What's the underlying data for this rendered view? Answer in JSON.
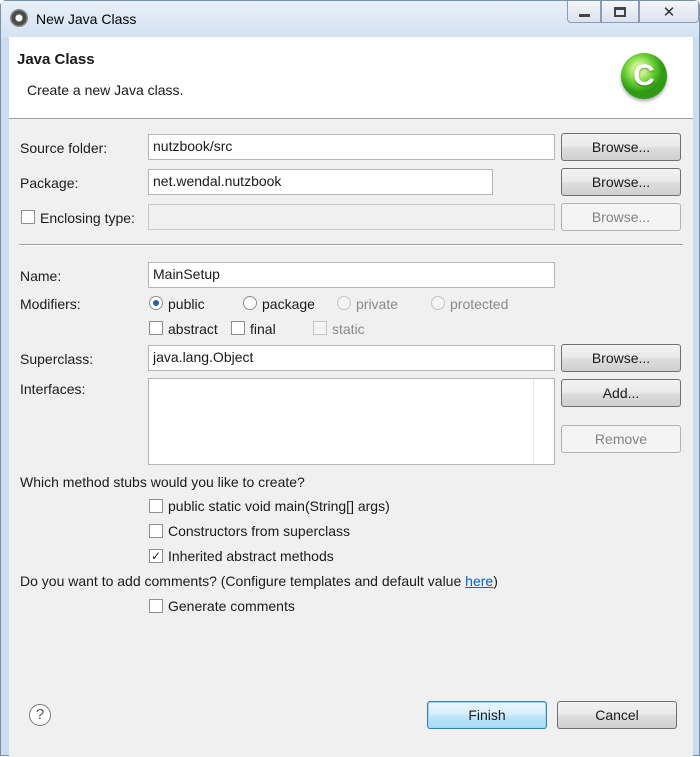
{
  "window": {
    "title": "New Java Class"
  },
  "header": {
    "title": "Java Class",
    "subtitle": "Create a new Java class.",
    "icon_letter": "C"
  },
  "form": {
    "source_folder": {
      "label": "Source folder:",
      "value": "nutzbook/src",
      "browse": "Browse..."
    },
    "package": {
      "label": "Package:",
      "value": "net.wendal.nutzbook",
      "browse": "Browse..."
    },
    "enclosing": {
      "label": "Enclosing type:",
      "value": "",
      "browse": "Browse...",
      "checked": false
    },
    "name": {
      "label": "Name:",
      "value": "MainSetup"
    },
    "modifiers": {
      "label": "Modifiers:",
      "radios": [
        "public",
        "package",
        "private",
        "protected"
      ],
      "selected": "public",
      "checks": [
        "abstract",
        "final",
        "static"
      ]
    },
    "superclass": {
      "label": "Superclass:",
      "value": "java.lang.Object",
      "browse": "Browse..."
    },
    "interfaces": {
      "label": "Interfaces:",
      "add": "Add...",
      "remove": "Remove"
    },
    "stubs": {
      "question": "Which method stubs would you like to create?",
      "options": [
        {
          "label": "public static void main(String[] args)",
          "checked": false
        },
        {
          "label": "Constructors from superclass",
          "checked": false
        },
        {
          "label": "Inherited abstract methods",
          "checked": true
        }
      ]
    },
    "comments": {
      "question_prefix": "Do you want to add comments? (Configure templates and default value ",
      "link": "here",
      "question_suffix": ")",
      "generate_label": "Generate comments",
      "checked": false
    }
  },
  "footer": {
    "help": "?",
    "finish": "Finish",
    "cancel": "Cancel"
  }
}
